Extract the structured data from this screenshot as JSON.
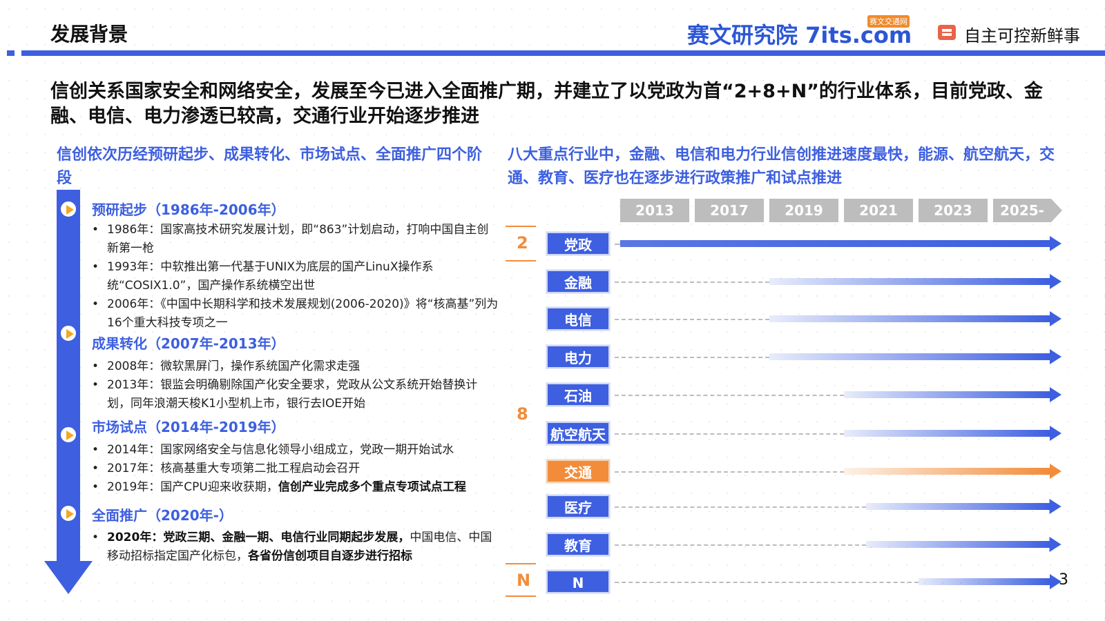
{
  "header": {
    "title": "发展背景",
    "brand_name": "赛文研究院",
    "brand_site": "7its.com",
    "brand_badge": "赛文交通网",
    "publisher": "自主可控新鲜事"
  },
  "headline": "信创关系国家安全和网络安全，发展至今已进入全面推广期，并建立了以党政为首“2+8+N”的行业体系，目前党政、金融、电信、电力渗透已较高，交通行业开始逐步推进",
  "left": {
    "subhead": "信创依次历经预研起步、成果转化、市场试点、全面推广四个阶段",
    "stages": [
      {
        "title": "预研起步（1986年-2006年）",
        "bullets": [
          {
            "text": "1986年：国家高技术研究发展计划，即“863”计划启动，打响中国自主创新第一枪"
          },
          {
            "text": "1993年：中软推出第一代基于UNIX为底层的国产LinuX操作系统“COSIX1.0”，国产操作系统横空出世"
          },
          {
            "text": "2006年：《中国中长期科学和技术发展规划(2006-2020)》将“核高基”列为16个重大科技专项之一"
          }
        ]
      },
      {
        "title": "成果转化（2007年-2013年）",
        "bullets": [
          {
            "text": "2008年：微软黑屏门，操作系统国产化需求走强"
          },
          {
            "text": "2013年：银监会明确剔除国产化安全要求，党政从公文系统开始替换计划，同年浪潮天梭K1小型机上市，银行去IOE开始"
          }
        ]
      },
      {
        "title": "市场试点（2014年-2019年）",
        "bullets": [
          {
            "text": "2014年：国家网络安全与信息化领导小组成立，党政一期开始试水"
          },
          {
            "text": "2017年：核高基重大专项第二批工程启动会召开"
          },
          {
            "text": "2019年：国产CPU迎来收获期，",
            "bold": "信创产业完成多个重点专项试点工程"
          }
        ]
      },
      {
        "title": "全面推广（2020年-）",
        "bullets": [
          {
            "bold_lead": "2020年：党政三期、金融一期、电信行业同期起步发展，",
            "text": "中国电信、中国移动招标指定国产化标包，",
            "bold": "各省份信创项目自逐步进行招标"
          }
        ]
      }
    ]
  },
  "right": {
    "subhead": "八大重点行业中，金融、电信和电力行业信创推进速度最快，能源、航空航天，交通、教育、医疗也在逐步进行政策推广和试点推进",
    "years": [
      "2013",
      "2017",
      "2019",
      "2021",
      "2023",
      "2025-"
    ],
    "groups": [
      {
        "label": "2"
      },
      {
        "label": "8"
      },
      {
        "label": "N"
      }
    ],
    "industries": [
      {
        "name": "党政",
        "start_year": 2013,
        "color": "#3d5fe0"
      },
      {
        "name": "金融",
        "start_year": 2019,
        "color": "#3d5fe0"
      },
      {
        "name": "电信",
        "start_year": 2019,
        "color": "#3d5fe0"
      },
      {
        "name": "电力",
        "start_year": 2019,
        "color": "#3d5fe0"
      },
      {
        "name": "石油",
        "start_year": 2021,
        "color": "#3d5fe0"
      },
      {
        "name": "航空航天",
        "start_year": 2021,
        "color": "#3d5fe0"
      },
      {
        "name": "交通",
        "start_year": 2021,
        "color": "#f28c3a"
      },
      {
        "name": "医疗",
        "start_year": 2021.6,
        "color": "#3d5fe0"
      },
      {
        "name": "教育",
        "start_year": 2021.6,
        "color": "#3d5fe0"
      },
      {
        "name": "N",
        "start_year": 2023,
        "color": "#3d5fe0"
      }
    ]
  },
  "page_number": "3",
  "colors": {
    "accent": "#3d5fe0",
    "highlight": "#f28c3a",
    "year_bar": "#bdbdbd"
  }
}
